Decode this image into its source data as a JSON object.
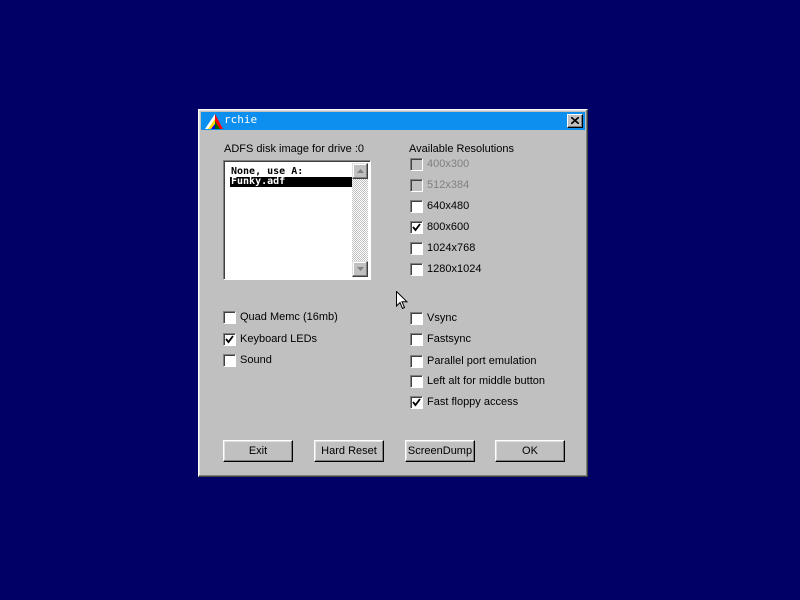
{
  "window": {
    "title": "rchie"
  },
  "colors": {
    "desktop": "#000066",
    "titlebar": "#0d8ff0",
    "dialog": "#c0c0c0",
    "disabled_text": "#808080"
  },
  "icons": {
    "app": "archie-logo-icon",
    "close": "close-icon",
    "scroll_up": "arrow-up-icon",
    "scroll_down": "arrow-down-icon",
    "checkmark": "checkmark-icon",
    "cursor": "mouse-cursor-icon"
  },
  "disk": {
    "label": "ADFS disk image for drive :0",
    "items": [
      {
        "text": "None, use A:",
        "selected": false
      },
      {
        "text": "Funky.adf",
        "selected": true
      }
    ]
  },
  "resolutions": {
    "label": "Available Resolutions",
    "items": [
      {
        "label": "400x300",
        "checked": false,
        "enabled": false
      },
      {
        "label": "512x384",
        "checked": false,
        "enabled": false
      },
      {
        "label": "640x480",
        "checked": false,
        "enabled": true
      },
      {
        "label": "800x600",
        "checked": true,
        "enabled": true
      },
      {
        "label": "1024x768",
        "checked": false,
        "enabled": true
      },
      {
        "label": "1280x1024",
        "checked": false,
        "enabled": true
      }
    ]
  },
  "left_options": [
    {
      "label": "Quad Memc (16mb)",
      "checked": false
    },
    {
      "label": "Keyboard LEDs",
      "checked": true
    },
    {
      "label": "Sound",
      "checked": false
    }
  ],
  "right_options": [
    {
      "label": "Vsync",
      "checked": false
    },
    {
      "label": "Fastsync",
      "checked": false
    },
    {
      "label": "Parallel port emulation",
      "checked": false
    },
    {
      "label": "Left alt for middle button",
      "checked": false
    },
    {
      "label": "Fast floppy access",
      "checked": true
    }
  ],
  "buttons": {
    "exit": "Exit",
    "hard_reset": "Hard Reset",
    "screendump": "ScreenDump",
    "ok": "OK"
  }
}
